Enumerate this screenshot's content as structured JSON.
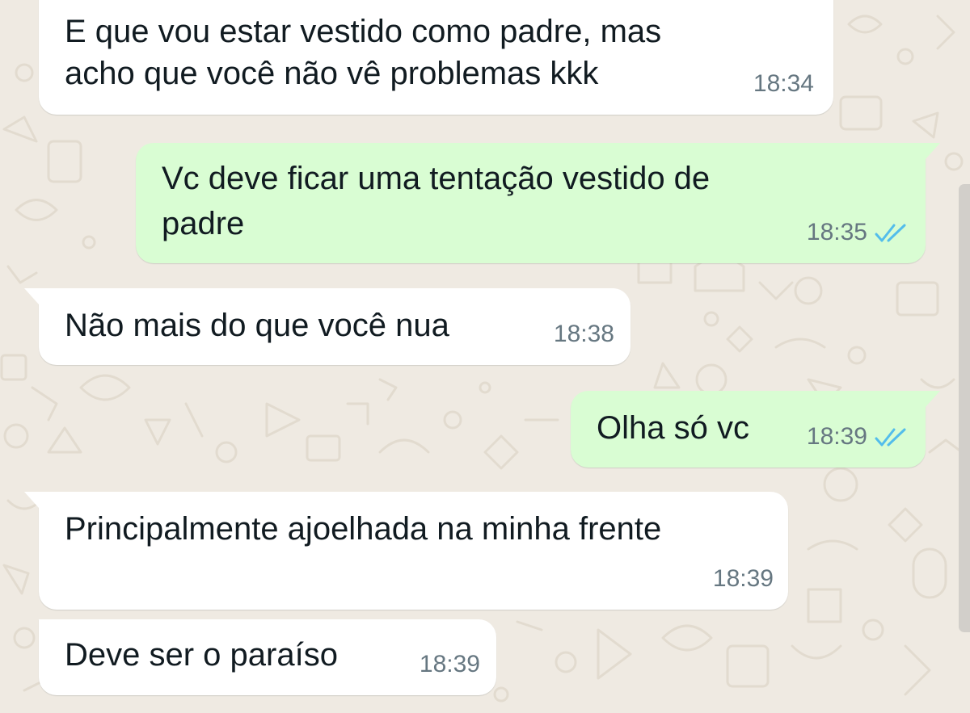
{
  "colors": {
    "wallpaper": "#efeae2",
    "incoming_bubble": "#ffffff",
    "outgoing_bubble": "#d9fdd3",
    "timestamp": "#667781",
    "read_ticks": "#53bdeb",
    "text": "#111b21"
  },
  "messages": [
    {
      "direction": "incoming",
      "lines": [
        "E que vou estar vestido como padre, mas",
        "acho que você não vê problemas kkk"
      ],
      "time": "18:34"
    },
    {
      "direction": "outgoing",
      "lines": [
        "Vc deve ficar uma tentação vestido de",
        "padre"
      ],
      "time": "18:35",
      "status_icon": "double-check-read-icon"
    },
    {
      "direction": "incoming",
      "lines": [
        "Não mais do que você nua"
      ],
      "time": "18:38"
    },
    {
      "direction": "outgoing",
      "lines": [
        "Olha só vc"
      ],
      "time": "18:39",
      "status_icon": "double-check-read-icon"
    },
    {
      "direction": "incoming",
      "lines": [
        "Principalmente ajoelhada na minha frente"
      ],
      "time": "18:39"
    },
    {
      "direction": "incoming",
      "lines": [
        "Deve ser o paraíso"
      ],
      "time": "18:39"
    }
  ]
}
